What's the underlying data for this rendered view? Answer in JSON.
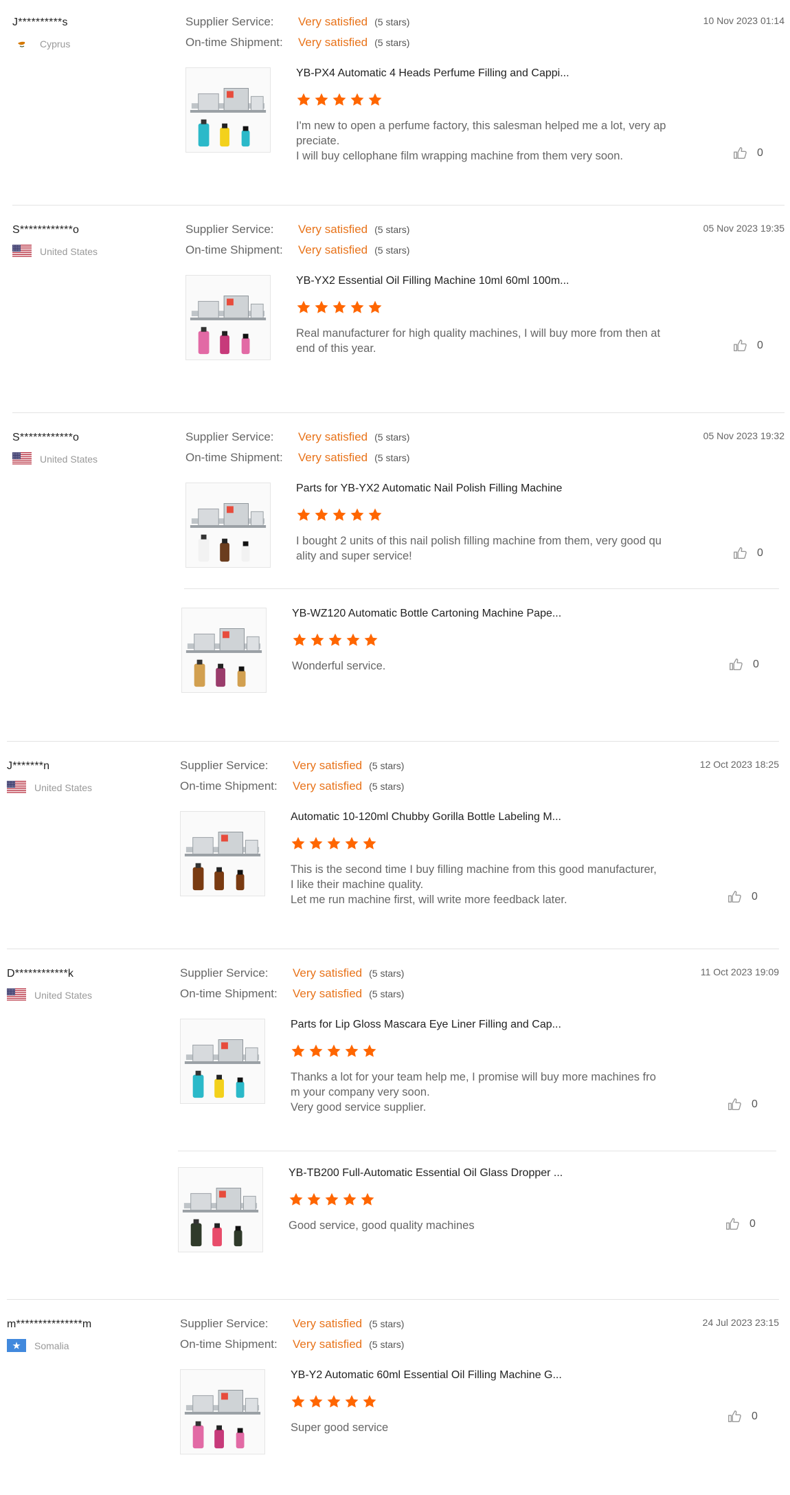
{
  "colors": {
    "accent": "#e8731a",
    "star": "#ff6600",
    "separator": "#e3e3e3"
  },
  "labels": {
    "supplier_service": "Supplier Service:",
    "ontime_shipment": "On-time Shipment:"
  },
  "reviews": [
    {
      "user": "J**********s",
      "country": "Cyprus",
      "flag_icon": "cyprus-flag-icon",
      "date": "10 Nov 2023 01:14",
      "supplier_rating": "Very satisfied",
      "supplier_stars": "(5 stars)",
      "shipment_rating": "Very satisfied",
      "shipment_stars": "(5 stars)",
      "items": [
        {
          "product": "YB-PX4 Automatic 4 Heads Perfume Filling and Cappi...",
          "rating": 5,
          "comment_lines": [
            "I'm new to open a perfume factory, this salesman helped me a lot, very ap",
            "preciate.",
            "I will buy cellophane film wrapping machine from them very soon."
          ],
          "likes": "0"
        }
      ]
    },
    {
      "user": "S************o",
      "country": "United States",
      "flag_icon": "us-flag-icon",
      "date": "05 Nov 2023 19:35",
      "supplier_rating": "Very satisfied",
      "supplier_stars": "(5 stars)",
      "shipment_rating": "Very satisfied",
      "shipment_stars": "(5 stars)",
      "items": [
        {
          "product": "YB-YX2 Essential Oil Filling Machine 10ml 60ml 100m...",
          "rating": 5,
          "comment_lines": [
            "Real manufacturer for high quality machines, I will buy more from then at",
            "end of this year."
          ],
          "likes": "0"
        }
      ]
    },
    {
      "user": "S************o",
      "country": "United States",
      "flag_icon": "us-flag-icon",
      "date": "05 Nov 2023 19:32",
      "supplier_rating": "Very satisfied",
      "supplier_stars": "(5 stars)",
      "shipment_rating": "Very satisfied",
      "shipment_stars": "(5 stars)",
      "items": [
        {
          "product": "Parts for YB-YX2 Automatic Nail Polish Filling Machine",
          "rating": 5,
          "comment_lines": [
            "I bought 2 units of this nail polish filling machine from them, very good qu",
            "ality and super service!"
          ],
          "likes": "0"
        },
        {
          "product": "YB-WZ120 Automatic Bottle Cartoning Machine Pape...",
          "rating": 5,
          "comment_lines": [
            "Wonderful service."
          ],
          "likes": "0"
        }
      ]
    },
    {
      "user": "J*******n",
      "country": "United States",
      "flag_icon": "us-flag-icon",
      "date": "12 Oct 2023 18:25",
      "supplier_rating": "Very satisfied",
      "supplier_stars": "(5 stars)",
      "shipment_rating": "Very satisfied",
      "shipment_stars": "(5 stars)",
      "items": [
        {
          "product": "Automatic 10-120ml Chubby Gorilla Bottle Labeling M...",
          "rating": 5,
          "comment_lines": [
            "This is the second time I buy filling machine from this good manufacturer,",
            "I like their machine quality.",
            "Let me run machine first, will write more feedback later."
          ],
          "likes": "0"
        }
      ]
    },
    {
      "user": "D************k",
      "country": "United States",
      "flag_icon": "us-flag-icon",
      "date": "11 Oct 2023 19:09",
      "supplier_rating": "Very satisfied",
      "supplier_stars": "(5 stars)",
      "shipment_rating": "Very satisfied",
      "shipment_stars": "(5 stars)",
      "items": [
        {
          "product": "Parts for Lip Gloss Mascara Eye Liner Filling and Cap...",
          "rating": 5,
          "comment_lines": [
            "Thanks a lot for your team help me, I promise will buy more machines fro",
            "m your company very soon.",
            "Very good service supplier."
          ],
          "likes": "0"
        },
        {
          "product": "YB-TB200 Full-Automatic Essential Oil Glass Dropper ...",
          "rating": 5,
          "comment_lines": [
            "Good service, good quality machines"
          ],
          "likes": "0"
        }
      ]
    },
    {
      "user": "m***************m",
      "country": "Somalia",
      "flag_icon": "somalia-flag-icon",
      "date": "24 Jul 2023 23:15",
      "supplier_rating": "Very satisfied",
      "supplier_stars": "(5 stars)",
      "shipment_rating": "Very satisfied",
      "shipment_stars": "(5 stars)",
      "items": [
        {
          "product": "YB-Y2 Automatic 60ml Essential Oil Filling Machine G...",
          "rating": 5,
          "comment_lines": [
            "Super good service"
          ],
          "likes": "0"
        }
      ]
    }
  ]
}
